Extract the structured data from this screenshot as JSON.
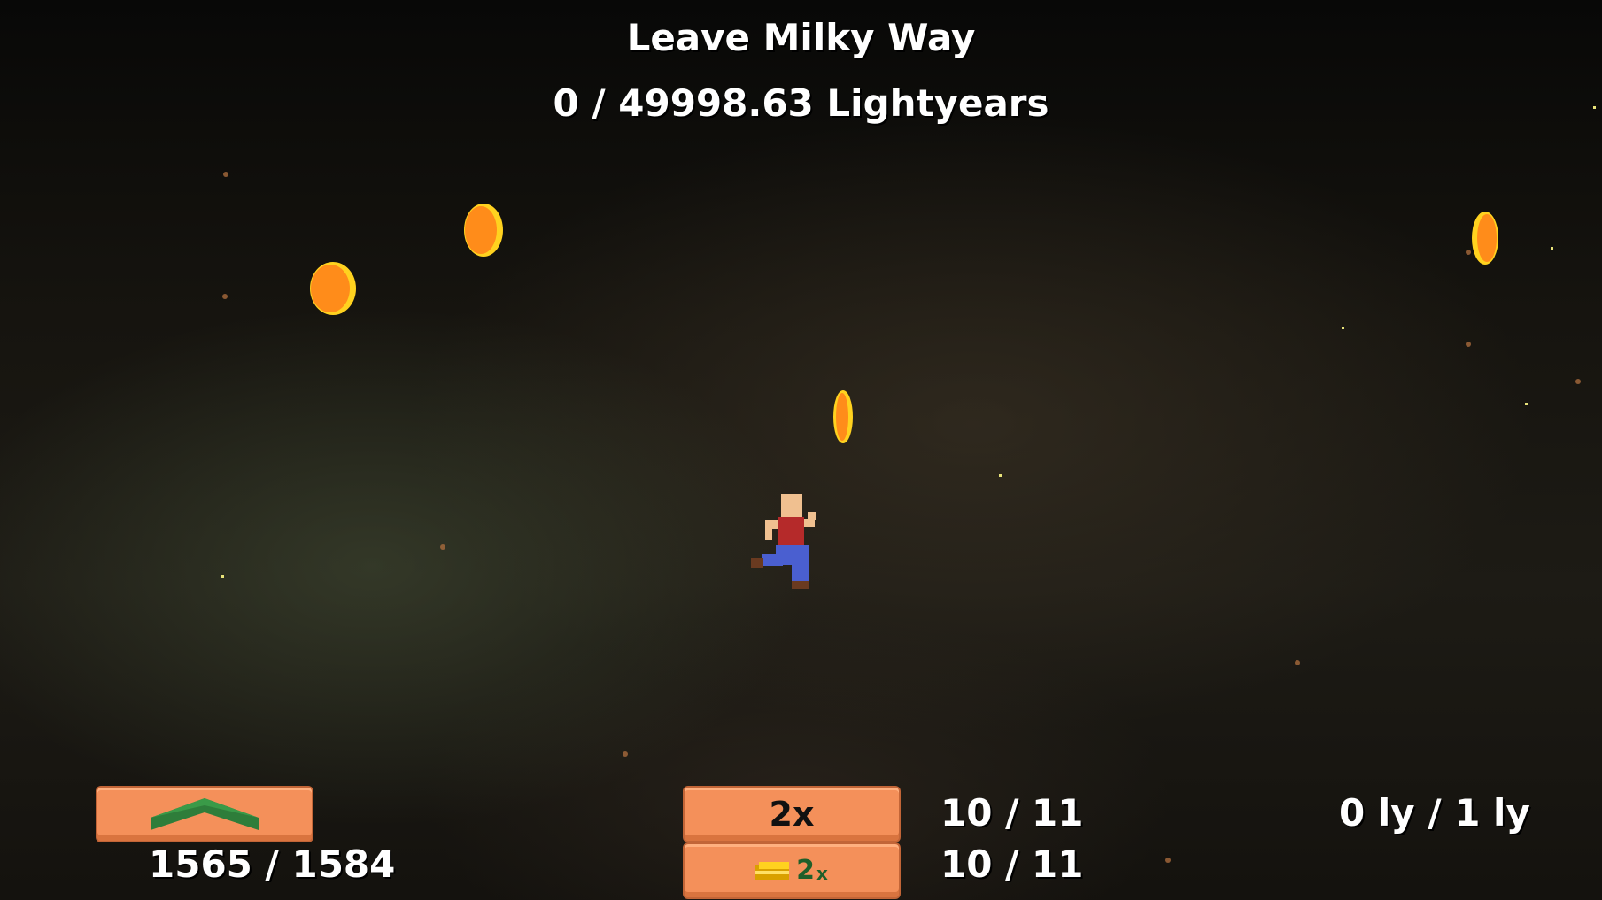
{
  "hud": {
    "goal_title": "Leave Milky Way",
    "goal_progress": "0 / 49998.63 Lightyears",
    "fuel_value": "1565 / 1584",
    "speed_multiplier_label": "2x",
    "speed_count": "10 / 11",
    "coin_multiplier_label": "2",
    "coin_multiplier_suffix": "x",
    "coin_count": "10 / 11",
    "distance_value": "0 ly / 1 ly"
  },
  "colors": {
    "button_fill": "#f4905a",
    "arrow_green": "#2e7d3a",
    "coin_orange": "#ff8c1a",
    "coin_yellow": "#ffd21f"
  },
  "icons": {
    "upgrade": "chevron-up-icon",
    "coin_stack": "coin-stack-icon",
    "coin": "coin-icon",
    "player": "player-character"
  }
}
